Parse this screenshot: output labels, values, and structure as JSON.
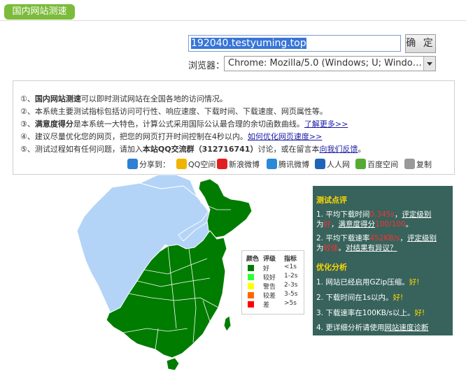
{
  "title_tag": "国内网站测速",
  "url_input": {
    "value": "192040.testyuming.top"
  },
  "submit_label": "确 定",
  "browser": {
    "label": "浏览器：",
    "value": "Chrome: Mozilla/5.0 (Windows; U; Windows..."
  },
  "info_lines": [
    {
      "n": "①、",
      "bold": "国内网站测速",
      "text": "可以即时测试网站在全国各地的访问情况。"
    },
    {
      "n": "②、",
      "bold": "",
      "text": "本系统主要测试指标包括访问可行性、响应速度、下载时间、下载速度、网页属性等。"
    },
    {
      "n": "③、",
      "bold": "满意度得分",
      "text": "是本系统一大特色，计算公式采用国际公认最合理的余切函数曲线。",
      "link": "了解更多>>"
    },
    {
      "n": "④、",
      "bold": "",
      "text": "建议尽量优化您的网页，把您的网页打开时间控制在4秒以内。",
      "link": "如何优化网页速度>>"
    },
    {
      "n": "⑤、",
      "bold": "",
      "text_a": "测试过程如有任何问题，请加入",
      "bold2": "本站QQ交流群（312716741）",
      "text_b": "讨论，或在留言本",
      "link": "向我们反馈",
      "tail": "。"
    }
  ],
  "share": {
    "label": "分享到：",
    "items": [
      "QQ空间",
      "新浪微博",
      "腾讯微博",
      "人人网",
      "百度空间",
      "复制"
    ],
    "colors": [
      "#f0b400",
      "#e02020",
      "#2a8ad8",
      "#1f64b9",
      "#55aa33",
      "#999999"
    ]
  },
  "legend": {
    "headers": [
      "颜色",
      "评级",
      "指标"
    ],
    "rows": [
      {
        "color": "#007c00",
        "level": "好",
        "index": "<1s"
      },
      {
        "color": "#33ff33",
        "level": "较好",
        "index": "1-2s"
      },
      {
        "color": "#ffff00",
        "level": "警告",
        "index": "2-3s"
      },
      {
        "color": "#ff6600",
        "level": "较差",
        "index": "3-5s"
      },
      {
        "color": "#ff0000",
        "level": "差",
        "index": ">5s"
      }
    ]
  },
  "panel": {
    "h1": "测试点评",
    "l1a": "1. 平均下载时间",
    "l1val": "0.345s",
    "l1b": "，",
    "l1link": "评定级别",
    "l2a": "为",
    "l2val": "好",
    "l2b": "，",
    "l2link": "满意度得分",
    "l2score": "100/100",
    "l2c": "。",
    "l3a": "2. 平均下载速率",
    "l3val": "452KB/s",
    "l3b": "，",
    "l3link": "评定级别",
    "l4a": "为",
    "l4val": "较佳",
    "l4b": "。",
    "l4link": "对结果有异议？",
    "h2": "优化分析",
    "o1": "1. 网站已经启用GZip压缩。",
    "o1ok": "好!",
    "o2": "2. 下载时间在1s以内。",
    "o2ok": "好!",
    "o3": "3. 下载速率在100KB/s以上。",
    "o3ok": "好!",
    "o4": "4. 更详细分析请使用",
    "o4link": "网站速度诊断"
  },
  "map_colors": {
    "tested": "#007c00",
    "untested": "#b3d4f7",
    "border": "#ffffff"
  }
}
